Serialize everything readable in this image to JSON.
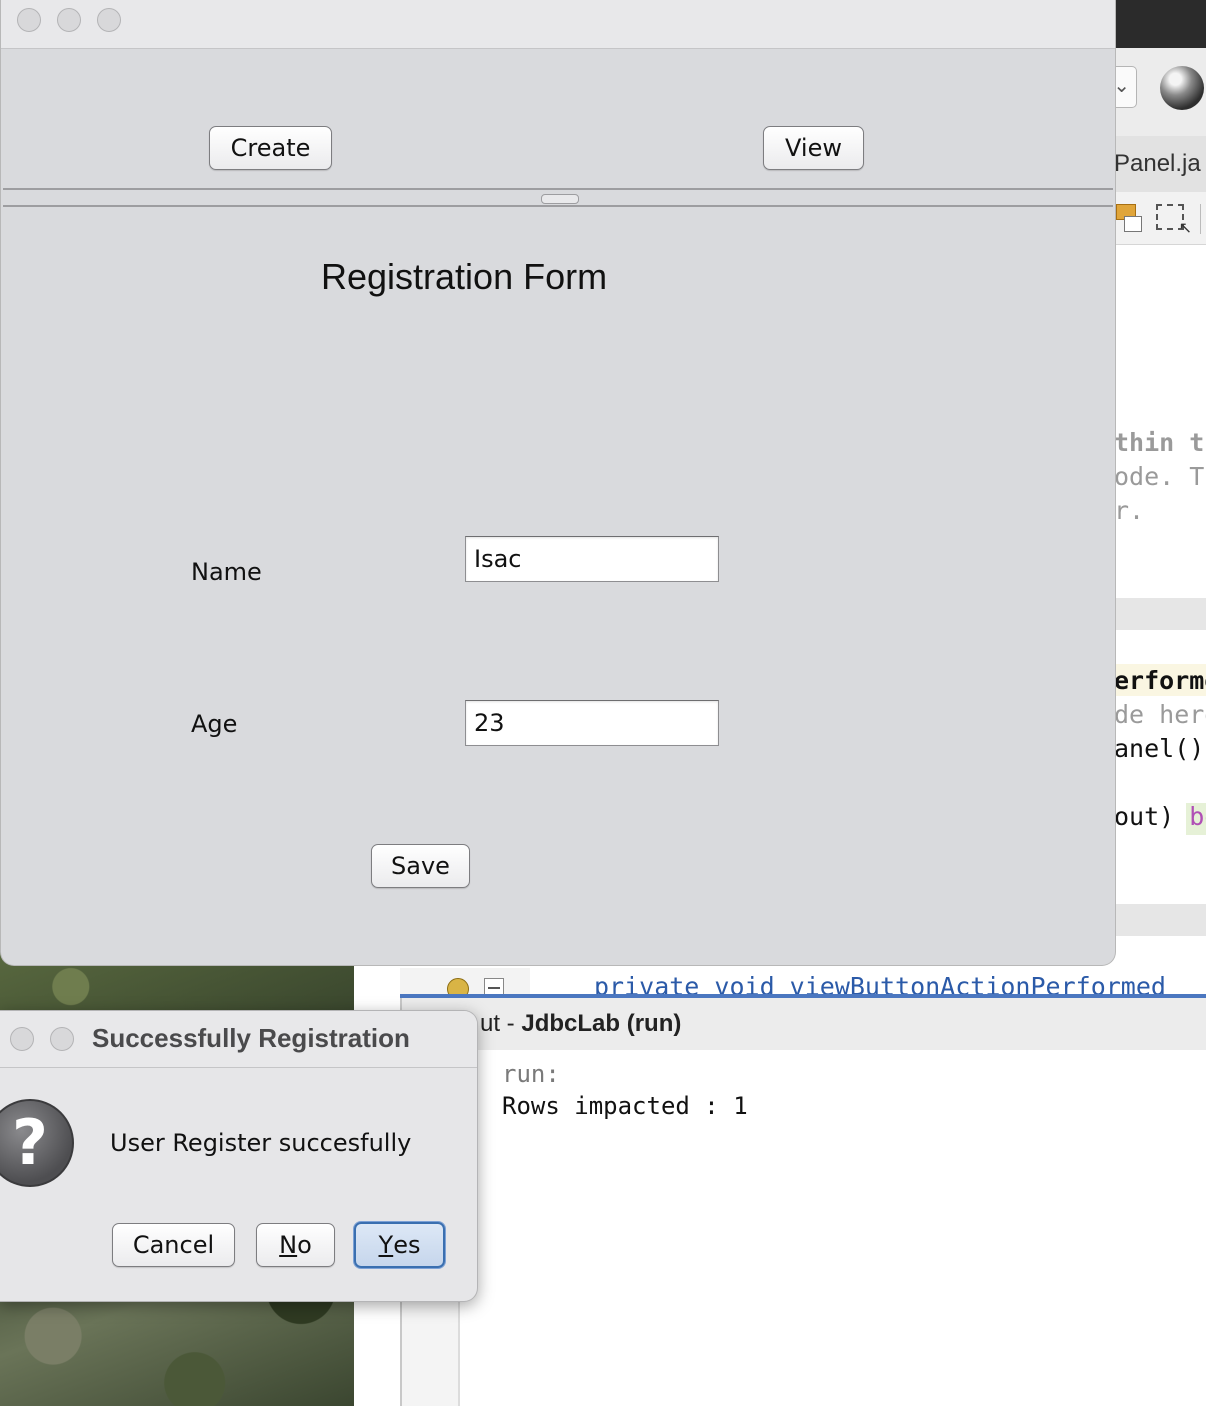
{
  "main_window": {
    "top_buttons": {
      "create": "Create",
      "view": "View"
    },
    "form": {
      "title": "Registration Form",
      "name_label": "Name",
      "name_value": "Isac",
      "age_label": "Age",
      "age_value": "23",
      "save": "Save"
    }
  },
  "dialog": {
    "title": "Successfully Registration",
    "message": "User Register succesfully",
    "buttons": {
      "cancel": "Cancel",
      "no_mnemonic": "N",
      "no_rest": "o",
      "yes_mnemonic": "Y",
      "yes_rest": "es"
    }
  },
  "ide": {
    "editor_tab": "Panel.ja",
    "code_lines": [
      "thin th",
      "ode. Th",
      "r.",
      "erforme",
      "de here",
      "anel()",
      "out) ",
      "be",
      "private void viewButtonActionPerformed"
    ],
    "output": {
      "title_prefix": "ut - ",
      "title_bold": "JdbcLab (run)",
      "lines": [
        "run:",
        "Rows impacted : 1"
      ]
    }
  }
}
